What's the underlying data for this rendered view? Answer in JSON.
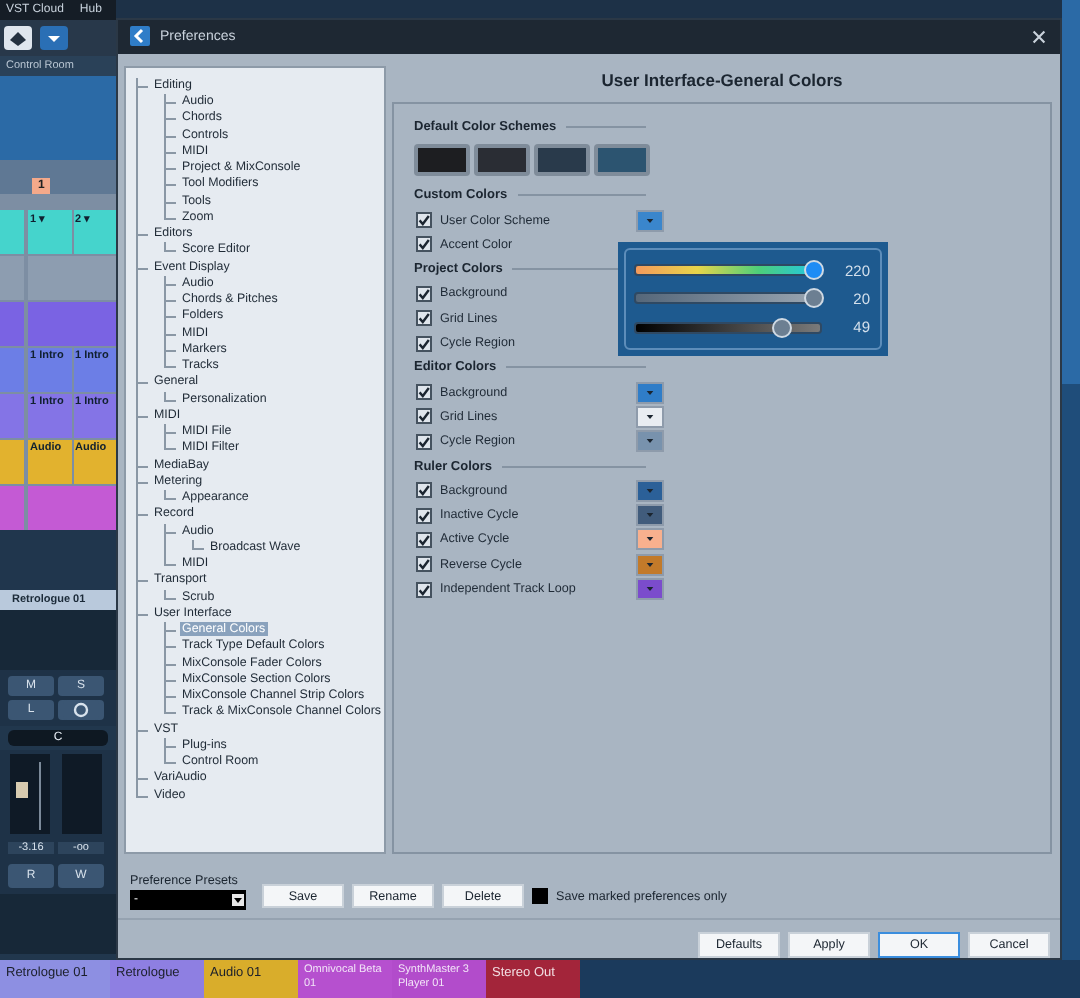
{
  "daw": {
    "menu": [
      "VST Cloud",
      "Hub"
    ],
    "control_room": "Control Room",
    "ruler_marker": "1",
    "clip_rows": [
      {
        "color": "#45d4cc",
        "clips": [
          "1 ▾",
          "2 ▾"
        ]
      },
      {
        "color": "#8d9db0",
        "clips": []
      },
      {
        "color": "#7a63e3",
        "clips": []
      },
      {
        "color": "#6c7ee6",
        "clips": [
          "1 Intro",
          "1 Intro"
        ]
      },
      {
        "color": "#8474e6",
        "clips": [
          "1 Intro",
          "1 Intro"
        ]
      },
      {
        "color": "#e2b22e",
        "clips": [
          "Audio",
          "Audio"
        ]
      },
      {
        "color": "#c45ad4",
        "clips": []
      }
    ],
    "channel": "Retrologue 01",
    "channel_buttons": [
      "M",
      "S",
      "L"
    ],
    "pan": "C",
    "readings": [
      "-3.16",
      "-oo"
    ],
    "rw": [
      "R",
      "W"
    ],
    "tracks": [
      {
        "label": "Retrologue 01",
        "color": "#8d8fe2"
      },
      {
        "label": "Retrologue",
        "color": "#8e7fe2"
      },
      {
        "label": "Audio 01",
        "color": "#d9ad2b"
      },
      {
        "label": "Omnivocal Beta 01",
        "color": "#b650cf"
      },
      {
        "label": "SynthMaster 3 Player 01",
        "color": "#b24ccb"
      },
      {
        "label": "Stereo Out",
        "color": "#a3253a"
      }
    ]
  },
  "dialog": {
    "title": "Preferences",
    "tree": [
      {
        "label": "Editing",
        "selected": false,
        "children": [
          {
            "label": "Audio",
            "selected": false
          },
          {
            "label": "Chords",
            "selected": false
          },
          {
            "label": "Controls",
            "selected": false
          },
          {
            "label": "MIDI",
            "selected": false
          },
          {
            "label": "Project & MixConsole",
            "selected": false
          },
          {
            "label": "Tool Modifiers",
            "selected": false
          },
          {
            "label": "Tools",
            "selected": false
          },
          {
            "label": "Zoom",
            "selected": false
          }
        ]
      },
      {
        "label": "Editors",
        "selected": false,
        "children": [
          {
            "label": "Score Editor",
            "selected": false
          }
        ]
      },
      {
        "label": "Event Display",
        "selected": false,
        "children": [
          {
            "label": "Audio",
            "selected": false
          },
          {
            "label": "Chords & Pitches",
            "selected": false
          },
          {
            "label": "Folders",
            "selected": false
          },
          {
            "label": "MIDI",
            "selected": false
          },
          {
            "label": "Markers",
            "selected": false
          },
          {
            "label": "Tracks",
            "selected": false
          }
        ]
      },
      {
        "label": "General",
        "selected": false,
        "children": [
          {
            "label": "Personalization",
            "selected": false
          }
        ]
      },
      {
        "label": "MIDI",
        "selected": false,
        "children": [
          {
            "label": "MIDI File",
            "selected": false
          },
          {
            "label": "MIDI Filter",
            "selected": false
          }
        ]
      },
      {
        "label": "MediaBay",
        "selected": false
      },
      {
        "label": "Metering",
        "selected": false,
        "children": [
          {
            "label": "Appearance",
            "selected": false
          }
        ]
      },
      {
        "label": "Record",
        "selected": false,
        "children": [
          {
            "label": "Audio",
            "selected": false,
            "children": [
              {
                "label": "Broadcast Wave",
                "selected": false
              }
            ]
          },
          {
            "label": "MIDI",
            "selected": false
          }
        ]
      },
      {
        "label": "Transport",
        "selected": false,
        "children": [
          {
            "label": "Scrub",
            "selected": false
          }
        ]
      },
      {
        "label": "User Interface",
        "selected": false,
        "children": [
          {
            "label": "General Colors",
            "selected": true
          },
          {
            "label": "Track Type Default Colors",
            "selected": false
          },
          {
            "label": "MixConsole Fader Colors",
            "selected": false
          },
          {
            "label": "MixConsole Section Colors",
            "selected": false
          },
          {
            "label": "MixConsole Channel Strip Colors",
            "selected": false
          },
          {
            "label": "Track & MixConsole Channel Colors",
            "selected": false
          }
        ]
      },
      {
        "label": "VST",
        "selected": false,
        "children": [
          {
            "label": "Plug-ins",
            "selected": false
          },
          {
            "label": "Control Room",
            "selected": false
          }
        ]
      },
      {
        "label": "VariAudio",
        "selected": false
      },
      {
        "label": "Video",
        "selected": false
      }
    ],
    "page_title": "User Interface-General Colors",
    "schemes_title": "Default Color Schemes",
    "schemes": [
      {
        "color": "#1d1e21"
      },
      {
        "color": "#2a2d34"
      },
      {
        "color": "#293a4b"
      },
      {
        "color": "#2c5470"
      }
    ],
    "sections": [
      {
        "title": "Custom Colors",
        "rows": [
          {
            "label": "User Color Scheme",
            "checked": true,
            "color": "#3a86cc"
          },
          {
            "label": "Accent Color",
            "checked": true
          }
        ]
      },
      {
        "title": "Project Colors",
        "rows": [
          {
            "label": "Background",
            "checked": true
          },
          {
            "label": "Grid Lines",
            "checked": true
          },
          {
            "label": "Cycle Region",
            "checked": true
          }
        ]
      },
      {
        "title": "Editor Colors",
        "rows": [
          {
            "label": "Background",
            "checked": true,
            "color": "#2f7dc8"
          },
          {
            "label": "Grid Lines",
            "checked": true,
            "color": "#e9edf2"
          },
          {
            "label": "Cycle Region",
            "checked": true,
            "color": "#7892ad"
          }
        ]
      },
      {
        "title": "Ruler Colors",
        "rows": [
          {
            "label": "Background",
            "checked": true,
            "color": "#2b6098"
          },
          {
            "label": "Inactive Cycle",
            "checked": true,
            "color": "#415c7c"
          },
          {
            "label": "Active Cycle",
            "checked": true,
            "color": "#f8b08e"
          },
          {
            "label": "Reverse Cycle",
            "checked": true,
            "color": "#c27a2a"
          },
          {
            "label": "Independent Track Loop",
            "checked": true,
            "color": "#7b4ccc"
          }
        ]
      }
    ],
    "popup": {
      "sliders": [
        {
          "kind": "hue",
          "level": 0.97,
          "reading": "220"
        },
        {
          "kind": "saturation",
          "level": 0.97,
          "reading": "20"
        },
        {
          "kind": "brightness",
          "level": 0.79,
          "reading": "49"
        }
      ]
    },
    "presets": {
      "label": "Preference Presets",
      "value": "-",
      "buttons": [
        "Save",
        "Rename",
        "Delete"
      ],
      "save_marked": {
        "label": "Save marked preferences only",
        "checked": false
      }
    },
    "buttons": [
      {
        "label": "Defaults",
        "selected": false
      },
      {
        "label": "Apply",
        "selected": false
      },
      {
        "label": "OK",
        "selected": true
      },
      {
        "label": "Cancel",
        "selected": false
      }
    ]
  }
}
